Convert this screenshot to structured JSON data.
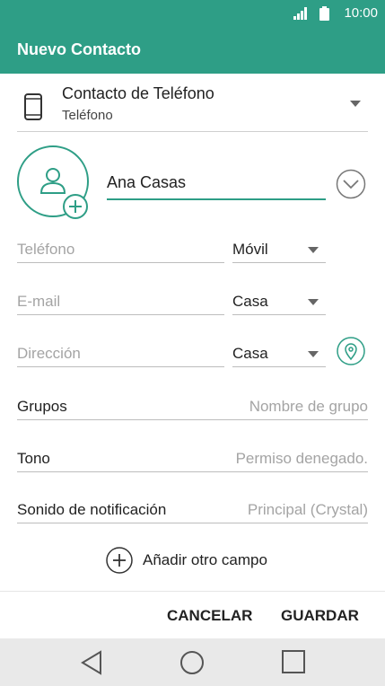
{
  "status_bar": {
    "time": "10:00"
  },
  "app_bar": {
    "title": "Nuevo Contacto"
  },
  "account": {
    "title": "Contacto de Teléfono",
    "subtitle": "Teléfono"
  },
  "contact": {
    "name": "Ana Casas"
  },
  "fields": {
    "phone": {
      "placeholder": "Teléfono",
      "type": "Móvil"
    },
    "email": {
      "placeholder": "E-mail",
      "type": "Casa"
    },
    "address": {
      "placeholder": "Dirección",
      "type": "Casa"
    }
  },
  "rows": {
    "groups": {
      "label": "Grupos",
      "value": "Nombre de grupo"
    },
    "ringtone": {
      "label": "Tono",
      "value": "Permiso denegado."
    },
    "notification": {
      "label": "Sonido de notificación",
      "value": "Principal (Crystal)"
    }
  },
  "add_field_label": "Añadir otro campo",
  "actions": {
    "cancel": "CANCELAR",
    "save": "GUARDAR"
  },
  "colors": {
    "accent": "#2e9e86"
  }
}
